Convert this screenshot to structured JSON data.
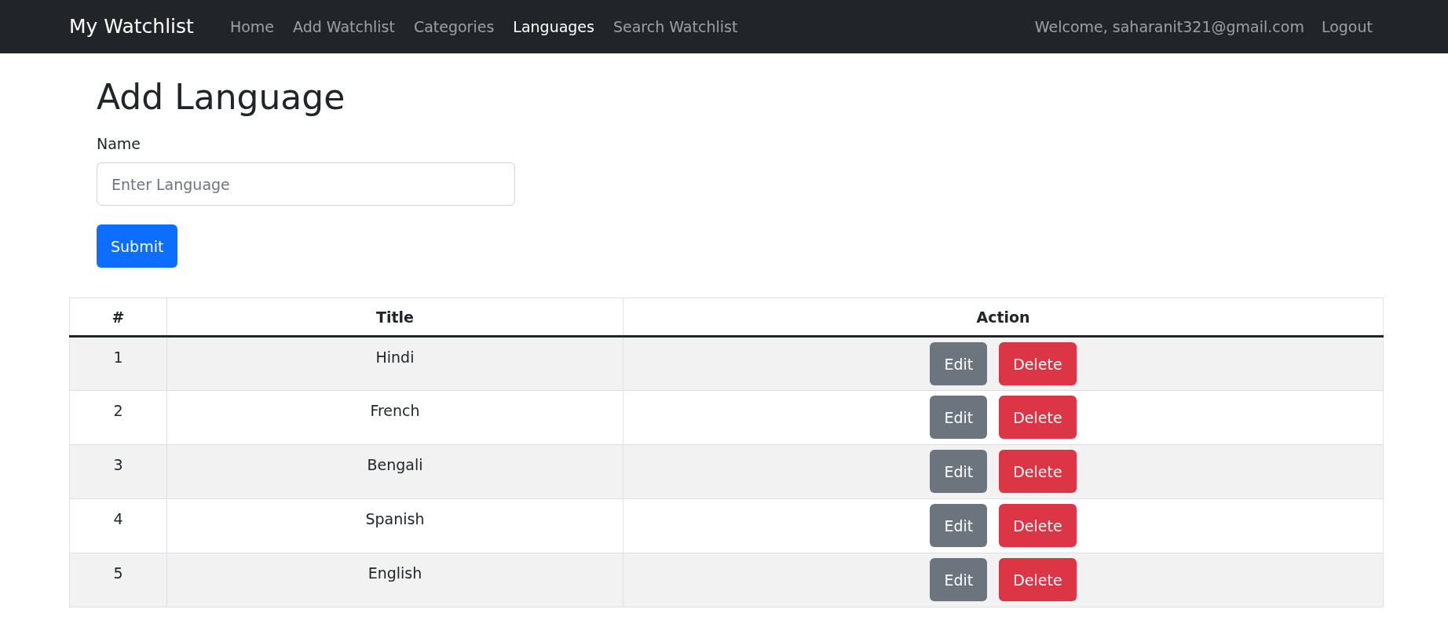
{
  "navbar": {
    "brand": "My Watchlist",
    "links": [
      {
        "label": "Home",
        "selected": false
      },
      {
        "label": "Add Watchlist",
        "selected": false
      },
      {
        "label": "Categories",
        "selected": false
      },
      {
        "label": "Languages",
        "selected": true
      },
      {
        "label": "Search Watchlist",
        "selected": false
      }
    ],
    "welcome": "Welcome, saharanit321@gmail.com",
    "logout": "Logout"
  },
  "form": {
    "heading": "Add Language",
    "label": "Name",
    "placeholder": "Enter Language",
    "submit": "Submit"
  },
  "table": {
    "columns": [
      "#",
      "Title",
      "Action"
    ],
    "rows": [
      {
        "index": "1",
        "title": "Hindi",
        "edit": "Edit",
        "delete": "Delete"
      },
      {
        "index": "2",
        "title": "French",
        "edit": "Edit",
        "delete": "Delete"
      },
      {
        "index": "3",
        "title": "Bengali",
        "edit": "Edit",
        "delete": "Delete"
      },
      {
        "index": "4",
        "title": "Spanish",
        "edit": "Edit",
        "delete": "Delete"
      },
      {
        "index": "5",
        "title": "English",
        "edit": "Edit",
        "delete": "Delete"
      }
    ]
  }
}
